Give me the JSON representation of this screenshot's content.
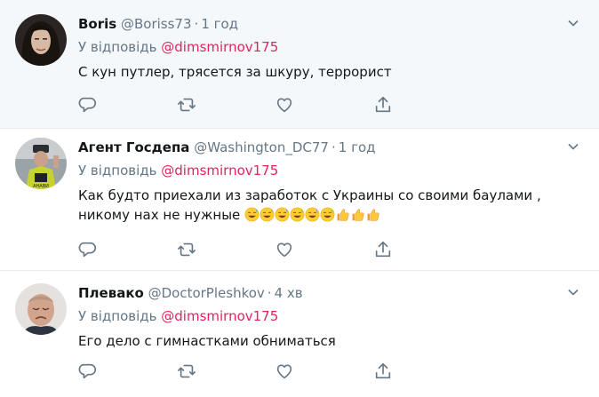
{
  "tweets": [
    {
      "name": "Boris",
      "handle": "@Boriss73",
      "dot": "·",
      "time": "1 год",
      "reply_prefix": "У відповідь",
      "reply_to": "@dimsmirnov175",
      "text": "С  кун путлер, трясется за шкуру, террорист",
      "avatar": "long-haired-man-avatar"
    },
    {
      "name": "Агент Госдепа",
      "handle": "@Washington_DC77",
      "dot": "·",
      "time": "1 год",
      "reply_prefix": "У відповідь",
      "reply_to": "@dimsmirnov175",
      "text": "Как будто приехали из заработок с Украины со своими баулами , никому нах не нужные",
      "emojis": [
        "sweat-smile-emoji",
        "sweat-smile-emoji",
        "sweat-smile-emoji",
        "sweat-smile-emoji",
        "sweat-smile-emoji",
        "sweat-smile-emoji",
        "thumbs-up-emoji",
        "thumbs-up-emoji",
        "thumbs-up-emoji"
      ],
      "avatar": "traffic-police-avatar"
    },
    {
      "name": "Плевако",
      "handle": "@DoctorPleshkov",
      "dot": "·",
      "time": "4 хв",
      "reply_prefix": "У відповідь",
      "reply_to": "@dimsmirnov175",
      "text": "Его дело с гимнастками обниматься",
      "avatar": "crying-man-avatar"
    }
  ],
  "icons": {
    "reply": "reply-icon",
    "retweet": "retweet-icon",
    "like": "heart-icon",
    "share": "share-icon",
    "caret": "chevron-down-icon"
  },
  "colors": {
    "link": "#e0245e",
    "muted": "#657786",
    "text": "#14171a",
    "icon": "#657786",
    "first_bg": "#f5f8fa",
    "divider": "#e6ecf0"
  }
}
